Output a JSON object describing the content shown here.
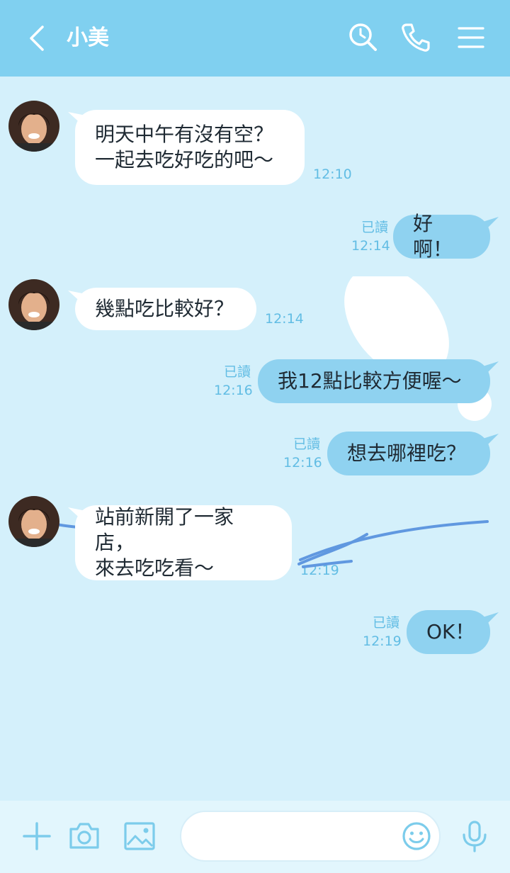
{
  "header": {
    "title": "小美"
  },
  "messages": [
    {
      "dir": "in",
      "text": "明天中午有沒有空？\n一起去吃好吃的吧～",
      "time": "12:10"
    },
    {
      "dir": "out",
      "text": "好啊！",
      "read": "已讀",
      "time": "12:14"
    },
    {
      "dir": "in",
      "text": "幾點吃比較好？",
      "time": "12:14"
    },
    {
      "dir": "out",
      "text": "我12點比較方便喔～",
      "read": "已讀",
      "time": "12:16"
    },
    {
      "dir": "out",
      "text": "想去哪裡吃？",
      "read": "已讀",
      "time": "12:16"
    },
    {
      "dir": "in",
      "text": "站前新開了一家店，\n來去吃吃看～",
      "time": "12:19"
    },
    {
      "dir": "out",
      "text": "OK！",
      "read": "已讀",
      "time": "12:19"
    }
  ],
  "composer": {
    "placeholder": ""
  },
  "colors": {
    "header": "#80d0f0",
    "background": "#d4f0fb",
    "outgoing_bubble": "#8fd2f0",
    "incoming_bubble": "#ffffff",
    "meta_text": "#62bde4"
  },
  "icons": [
    "back-icon",
    "search-icon",
    "phone-icon",
    "menu-icon",
    "plus-icon",
    "camera-icon",
    "image-icon",
    "emoji-icon",
    "microphone-icon"
  ]
}
